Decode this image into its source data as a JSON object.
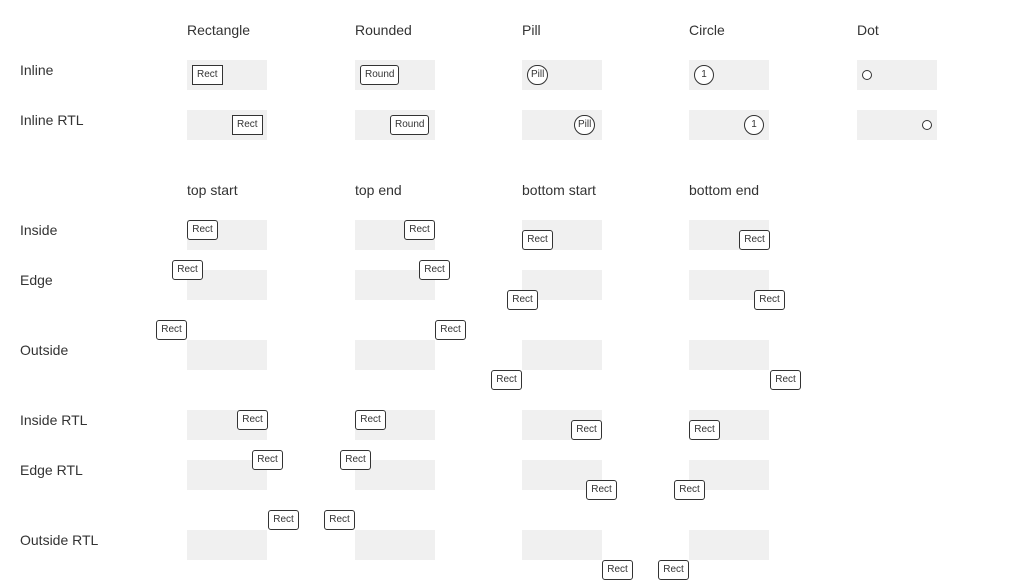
{
  "styles": {
    "headers": [
      "Rectangle",
      "Rounded",
      "Pill",
      "Circle",
      "Dot"
    ],
    "rows": [
      "Inline",
      "Inline RTL"
    ],
    "badges": [
      "Rect",
      "Round",
      "Pill",
      "1",
      ""
    ]
  },
  "positions": {
    "headers": [
      "top start",
      "top end",
      "bottom start",
      "bottom end"
    ],
    "rows": [
      "Inside",
      "Edge",
      "Outside",
      "Inside RTL",
      "Edge RTL",
      "Outside RTL"
    ],
    "badge_label": "Rect"
  }
}
